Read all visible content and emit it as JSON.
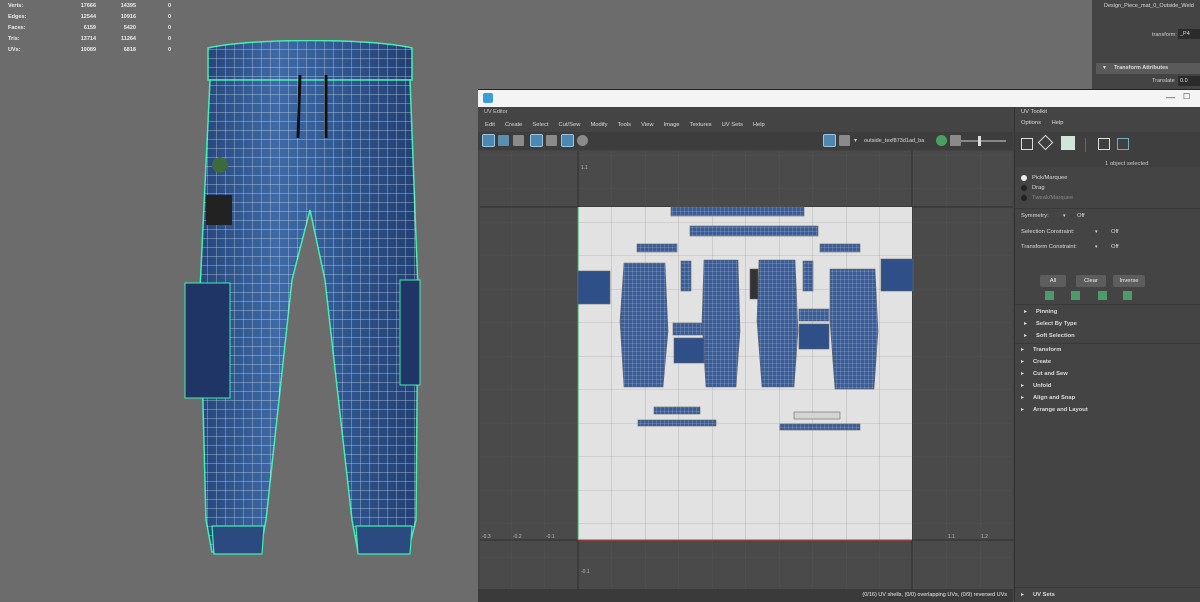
{
  "hud": {
    "rows": [
      {
        "label": "Verts:",
        "a": "17666",
        "b": "14395",
        "c": "0"
      },
      {
        "label": "Edges:",
        "a": "12544",
        "b": "10916",
        "c": "0"
      },
      {
        "label": "Faces:",
        "a": "6159",
        "b": "5420",
        "c": "0"
      },
      {
        "label": "Tris:",
        "a": "13714",
        "b": "11264",
        "c": "0"
      },
      {
        "label": "UVs:",
        "a": "10089",
        "b": "6818",
        "c": "0"
      }
    ]
  },
  "attr": {
    "title": "Design_Piece_mat_0_Outside_Weld",
    "transform_label": "transform:",
    "transform_value": "_P4",
    "section": "Transform Attributes",
    "translate_label": "Translate",
    "translate_value": "0.0"
  },
  "uv_editor": {
    "title": "UV Editor",
    "menus": [
      "Edit",
      "Create",
      "Select",
      "Cut/Sew",
      "Modify",
      "Tools",
      "View",
      "Image",
      "Textures",
      "UV Sets",
      "Help"
    ],
    "texture_name": "outside_texf873d1ad_ba",
    "axis_labels": {
      "top_left": "1.1",
      "bottom_left": "-0.1",
      "b1": "-0.3",
      "b2": "-0.2",
      "b3": "-0.1",
      "b4": "1.1",
      "b5": "1.2"
    },
    "status": "(0/16) UV shells, (0/0) overlapping UVs, (0/9) reversed UVs"
  },
  "toolkit": {
    "title": "UV Toolkit",
    "menus": [
      "Options",
      "Help"
    ],
    "selected_count": "1 object selected",
    "radios": [
      "Pick/Marquee",
      "Drag",
      "Tweak/Marquee"
    ],
    "symmetry": {
      "label": "Symmetry:",
      "value": "Off"
    },
    "selection_constraint": {
      "label": "Selection Constraint:",
      "value": "Off"
    },
    "transform_constraint": {
      "label": "Transform Constraint:",
      "value": "Off"
    },
    "buttons": {
      "all": "All",
      "clear": "Clear",
      "inverse": "Inverse"
    },
    "subsections": [
      "Pinning",
      "Select By Type",
      "Soft Selection"
    ],
    "sections": [
      "Transform",
      "Create",
      "Cut and Sew",
      "Unfold",
      "Align and Snap",
      "Arrange and Layout"
    ],
    "footer_section": "UV Sets"
  }
}
